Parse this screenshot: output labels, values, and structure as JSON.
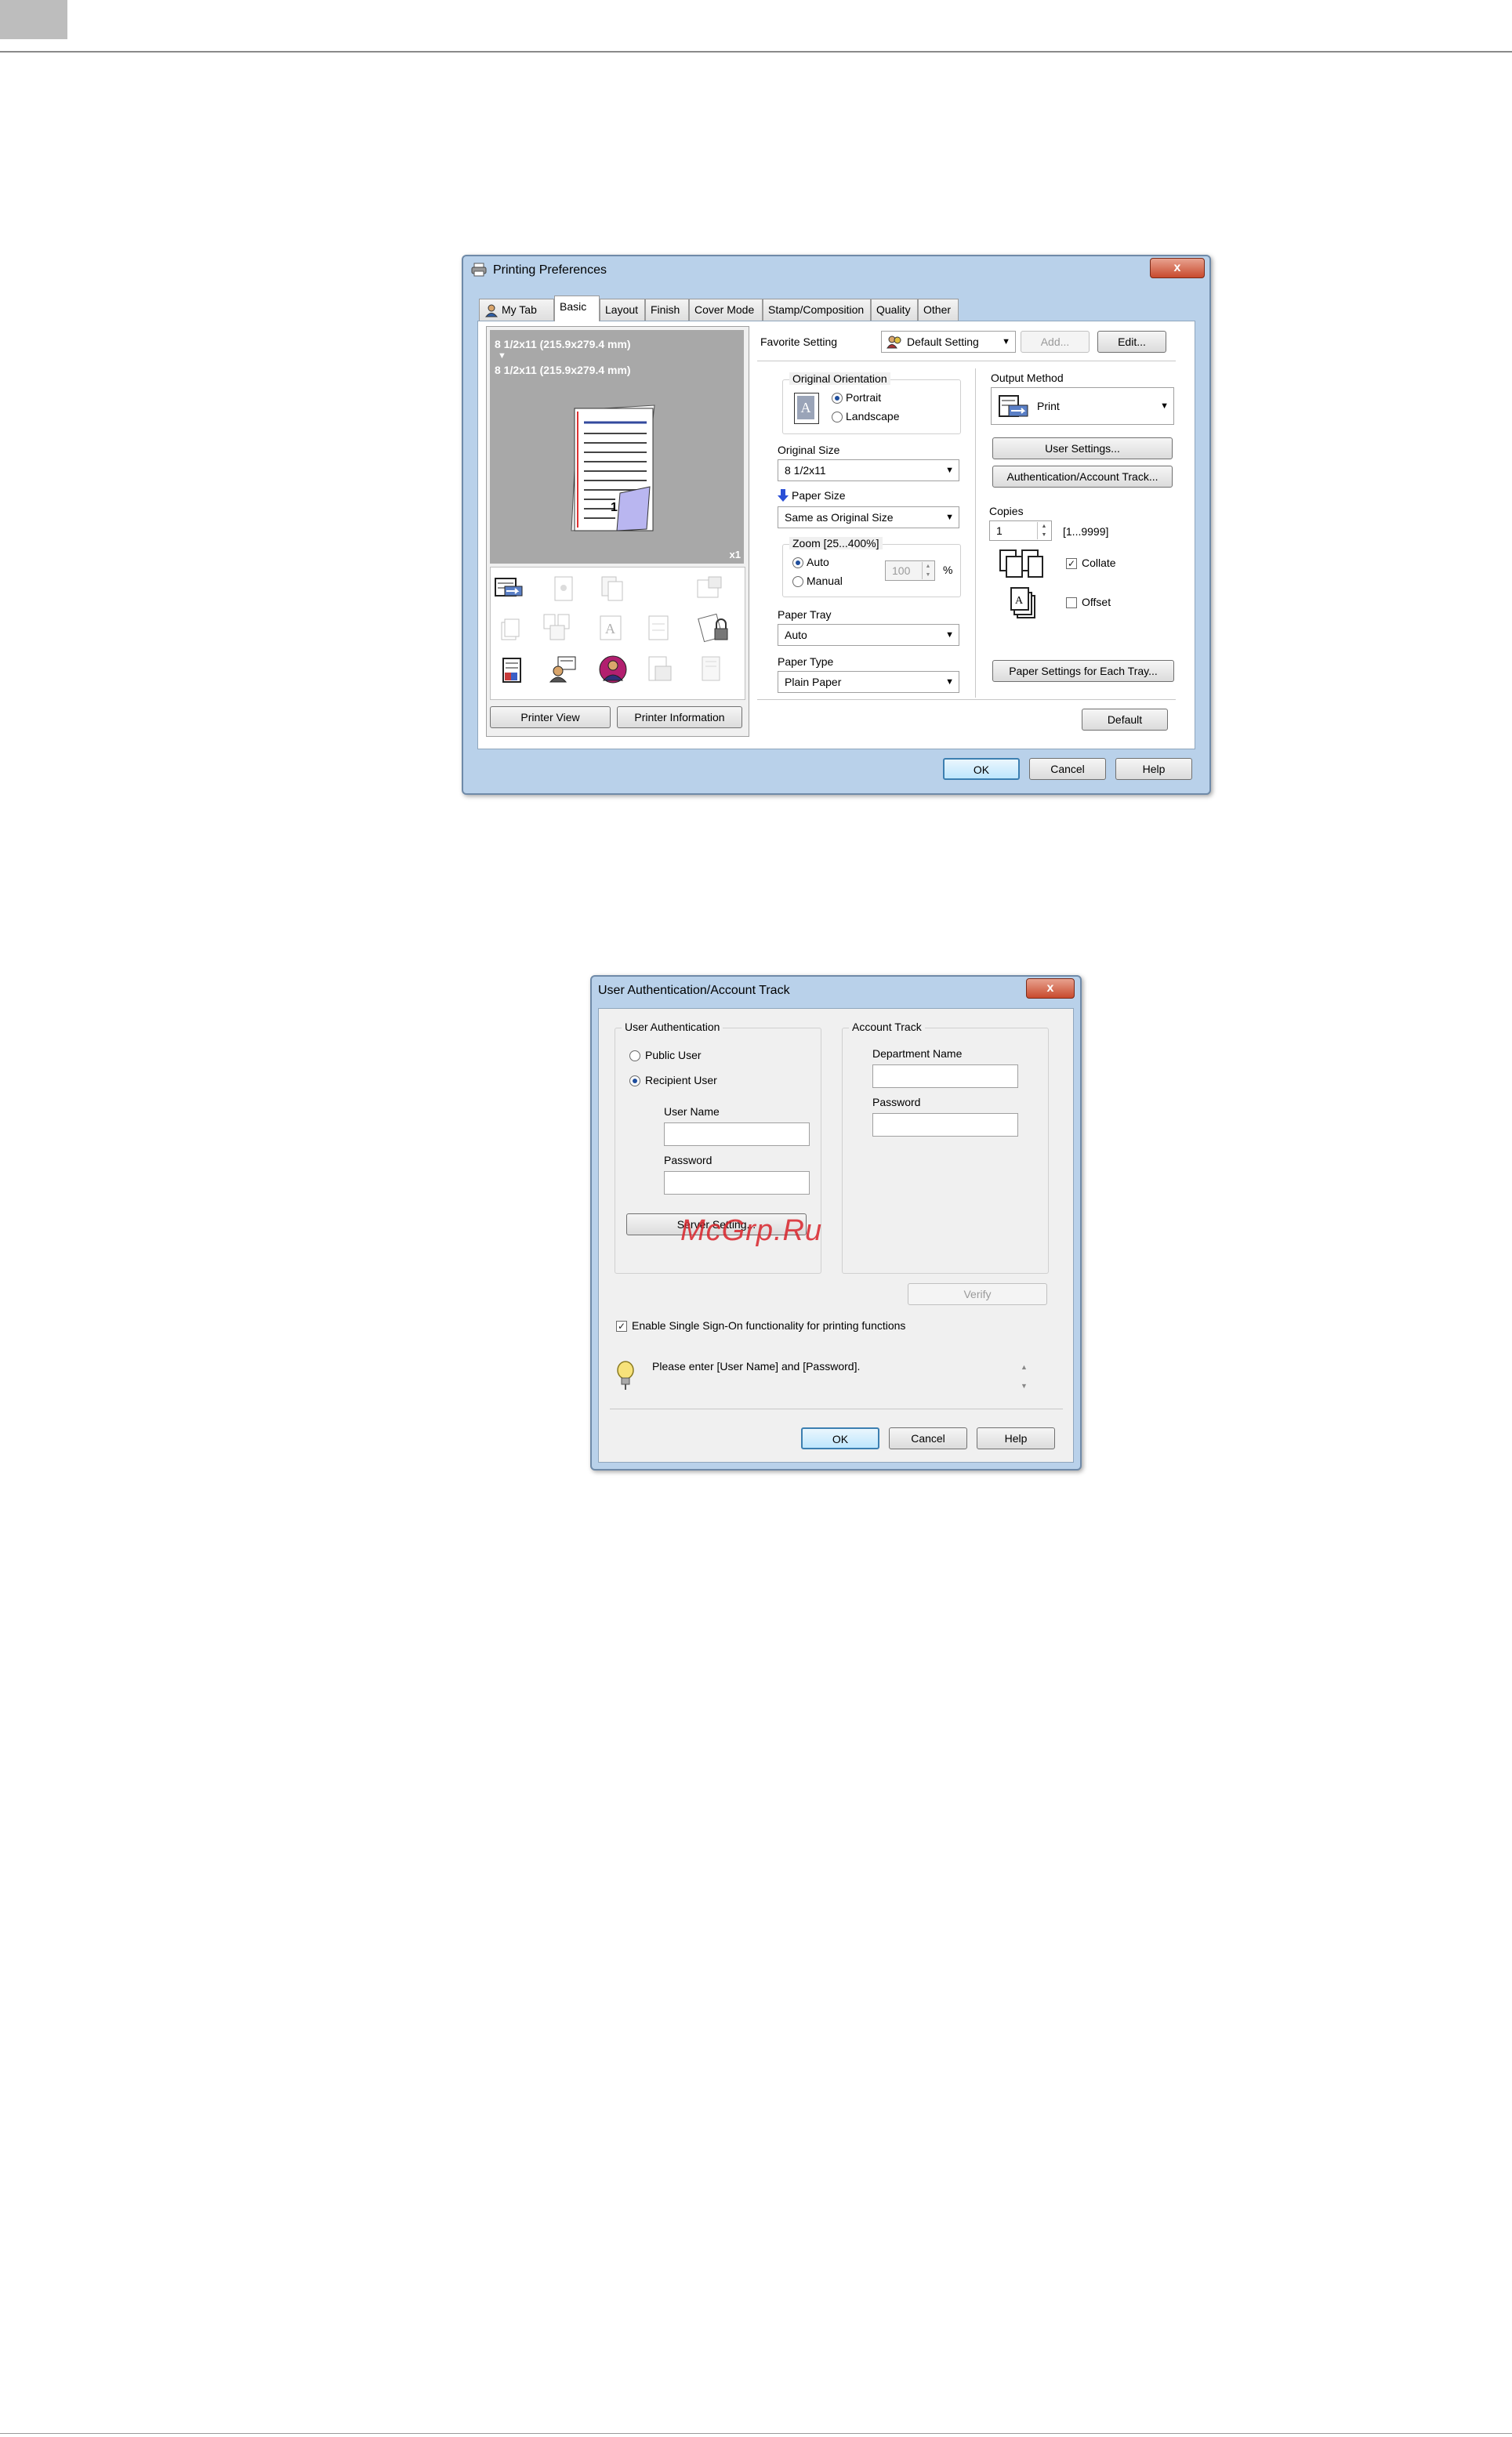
{
  "printing_preferences": {
    "title": "Printing Preferences",
    "close_label": "x",
    "tabs": [
      "My Tab",
      "Basic",
      "Layout",
      "Finish",
      "Cover Mode",
      "Stamp/Composition",
      "Quality",
      "Other"
    ],
    "active_tab": "Basic",
    "preview": {
      "original_line": "8 1/2x11 (215.9x279.4 mm)",
      "down_arrow": "▼",
      "output_line": "8 1/2x11 (215.9x279.4 mm)",
      "multiplier": "x1",
      "page_number": "1"
    },
    "printer_view_label": "Printer View",
    "printer_information_label": "Printer Information",
    "favorite_setting": {
      "label": "Favorite Setting",
      "value": "Default Setting",
      "add_label": "Add...",
      "edit_label": "Edit..."
    },
    "original_orientation": {
      "label": "Original Orientation",
      "portrait": "Portrait",
      "landscape": "Landscape",
      "selected": "Portrait"
    },
    "original_size": {
      "label": "Original Size",
      "value": "8 1/2x11"
    },
    "paper_size": {
      "label": "Paper Size",
      "value": "Same as Original Size"
    },
    "zoom": {
      "label": "Zoom [25...400%]",
      "auto": "Auto",
      "manual": "Manual",
      "value": "100",
      "unit": "%",
      "selected": "Auto"
    },
    "paper_tray": {
      "label": "Paper Tray",
      "value": "Auto"
    },
    "paper_type": {
      "label": "Paper Type",
      "value": "Plain Paper"
    },
    "output_method": {
      "label": "Output Method",
      "value": "Print"
    },
    "user_settings_label": "User Settings...",
    "auth_account_track_label": "Authentication/Account Track...",
    "copies": {
      "label": "Copies",
      "value": "1",
      "range": "[1...9999]"
    },
    "collate": {
      "label": "Collate",
      "checked": true
    },
    "offset": {
      "label": "Offset",
      "checked": false
    },
    "paper_settings_each_tray_label": "Paper Settings for Each Tray...",
    "default_label": "Default",
    "ok_label": "OK",
    "cancel_label": "Cancel",
    "help_label": "Help"
  },
  "auth_dialog": {
    "title": "User Authentication/Account Track",
    "close_label": "x",
    "user_authentication": {
      "label": "User Authentication",
      "public_user": "Public User",
      "recipient_user": "Recipient User",
      "selected": "Recipient User",
      "user_name_label": "User Name",
      "user_name_value": "",
      "password_label": "Password",
      "password_value": "",
      "server_setting_label": "Server Setting..."
    },
    "account_track": {
      "label": "Account Track",
      "department_name_label": "Department Name",
      "department_name_value": "",
      "password_label": "Password",
      "password_value": ""
    },
    "verify_label": "Verify",
    "sso": {
      "label": "Enable Single Sign-On functionality for printing functions",
      "checked": true
    },
    "hint": "Please enter [User Name] and [Password].",
    "scroll_up": "▲",
    "scroll_down": "▼",
    "ok_label": "OK",
    "cancel_label": "Cancel",
    "help_label": "Help"
  },
  "watermark": "McGrp.Ru",
  "colors": {
    "titlebar": "#b9d1ea",
    "close_button": "#c84a2e",
    "watermark": "#d9232a",
    "preview_bg": "#a8a8a8"
  }
}
